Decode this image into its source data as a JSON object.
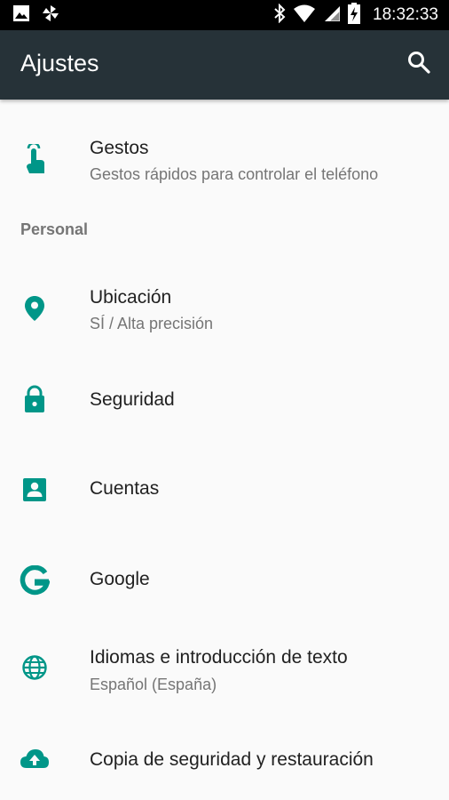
{
  "status_bar": {
    "time": "18:32:33",
    "left_icons": [
      "image-icon",
      "pinwheel-icon"
    ],
    "right_icons": [
      "bluetooth-icon",
      "wifi-icon",
      "cell-signal-icon",
      "battery-charging-icon"
    ]
  },
  "app_bar": {
    "title": "Ajustes",
    "search_icon": "search-icon",
    "background": "#263238"
  },
  "accent_color": "#009688",
  "sections": [
    {
      "header": "",
      "items": [
        {
          "icon": "gesture-touch-icon",
          "title": "Gestos",
          "subtitle": "Gestos rápidos para controlar el teléfono"
        }
      ]
    },
    {
      "header": "Personal",
      "items": [
        {
          "icon": "location-pin-icon",
          "title": "Ubicación",
          "subtitle": "SÍ / Alta precisión"
        },
        {
          "icon": "lock-icon",
          "title": "Seguridad",
          "subtitle": ""
        },
        {
          "icon": "account-box-icon",
          "title": "Cuentas",
          "subtitle": ""
        },
        {
          "icon": "google-g-icon",
          "title": "Google",
          "subtitle": ""
        },
        {
          "icon": "globe-icon",
          "title": "Idiomas e introducción de texto",
          "subtitle": "Español (España)"
        },
        {
          "icon": "cloud-upload-icon",
          "title": "Copia de seguridad y restauración",
          "subtitle": ""
        }
      ]
    }
  ]
}
